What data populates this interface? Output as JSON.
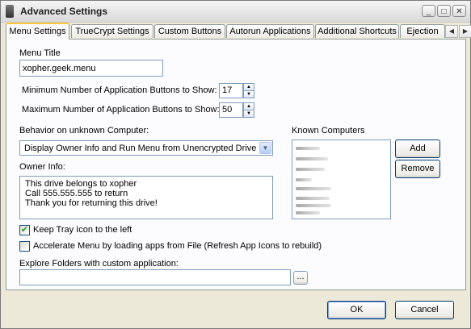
{
  "window": {
    "title": "Advanced Settings",
    "controls": {
      "minimize": "_",
      "maximize": "□",
      "close": "✕"
    }
  },
  "tabs": [
    {
      "label": "Menu Settings",
      "active": true
    },
    {
      "label": "TrueCrypt Settings"
    },
    {
      "label": "Custom Buttons"
    },
    {
      "label": "Autorun Applications"
    },
    {
      "label": "Additional Shortcuts"
    },
    {
      "label": "Ejection"
    }
  ],
  "tab_scroll": {
    "left": "◀",
    "right": "▶"
  },
  "menu_title": {
    "label": "Menu Title",
    "value": "xopher.geek.menu"
  },
  "min_buttons": {
    "label": "Minimum Number of Application Buttons to Show:",
    "value": "17"
  },
  "max_buttons": {
    "label": "Maximum Number of Application Buttons to Show:",
    "value": "50"
  },
  "spinner": {
    "up": "▲",
    "down": "▼"
  },
  "behavior": {
    "label": "Behavior on unknown Computer:",
    "selected": "Display Owner Info and Run Menu from Unencrypted Drive",
    "arrow": "▼"
  },
  "owner_info": {
    "label": "Owner Info:",
    "lines": [
      "This drive belongs to xopher",
      "Call 555.555.555 to return",
      "Thank you for returning this drive!"
    ]
  },
  "known_computers": {
    "label": "Known Computers",
    "add_button": "Add",
    "remove_button": "Remove"
  },
  "keep_tray": {
    "label": "Keep Tray Icon to the left",
    "checked": true,
    "mark": "✔"
  },
  "accelerate": {
    "label": "Accelerate Menu by loading apps from File (Refresh App Icons to rebuild)",
    "checked": false
  },
  "explore": {
    "label": "Explore Folders with custom application:",
    "value": "",
    "browse_button": "..."
  },
  "footer": {
    "ok_button": "OK",
    "cancel_button": "Cancel"
  },
  "colors": {
    "tab_highlight": "#ffc73c",
    "check_green": "#21a121",
    "button_border": "#003c74",
    "field_border": "#7f9db9"
  }
}
